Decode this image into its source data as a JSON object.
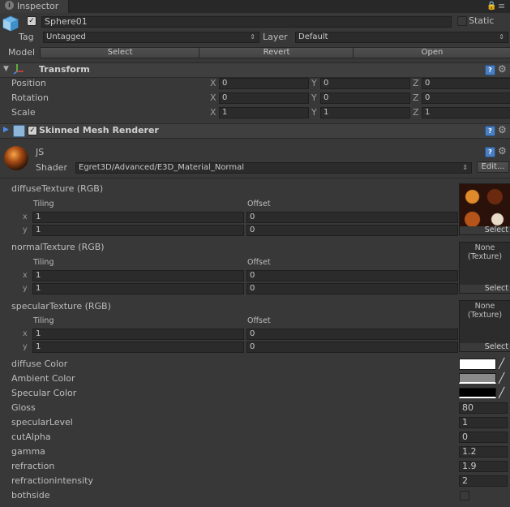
{
  "tab": {
    "label": "Inspector"
  },
  "object": {
    "name": "Sphere01",
    "static_label": "Static",
    "tag_label": "Tag",
    "tag_value": "Untagged",
    "layer_label": "Layer",
    "layer_value": "Default",
    "model_label": "Model",
    "model_buttons": [
      "Select",
      "Revert",
      "Open"
    ]
  },
  "transform": {
    "title": "Transform",
    "rows": [
      {
        "label": "Position",
        "x": "0",
        "y": "0",
        "z": "0"
      },
      {
        "label": "Rotation",
        "x": "0",
        "y": "0",
        "z": "0"
      },
      {
        "label": "Scale",
        "x": "1",
        "y": "1",
        "z": "1"
      }
    ],
    "axes": [
      "X",
      "Y",
      "Z"
    ]
  },
  "renderer": {
    "title": "Skinned Mesh Renderer"
  },
  "material": {
    "name": "JS",
    "shader_label": "Shader",
    "shader_value": "Egret3D/Advanced/E3D_Material_Normal",
    "edit_label": "Edit..."
  },
  "textures": [
    {
      "label": "diffuseTexture (RGB)",
      "tiling_label": "Tiling",
      "offset_label": "Offset",
      "tiling_x": "1",
      "tiling_y": "1",
      "offset_x": "0",
      "offset_y": "0",
      "preview": "image",
      "select_label": "Select"
    },
    {
      "label": "normalTexture (RGB)",
      "tiling_label": "Tiling",
      "offset_label": "Offset",
      "tiling_x": "1",
      "tiling_y": "1",
      "offset_x": "0",
      "offset_y": "0",
      "preview": "None (Texture)",
      "select_label": "Select"
    },
    {
      "label": "specularTexture (RGB)",
      "tiling_label": "Tiling",
      "offset_label": "Offset",
      "tiling_x": "1",
      "tiling_y": "1",
      "offset_x": "0",
      "offset_y": "0",
      "preview": "None (Texture)",
      "select_label": "Select"
    }
  ],
  "axis_x": "x",
  "axis_y": "y",
  "colors": [
    {
      "label": "diffuse Color",
      "hex": "#ffffff"
    },
    {
      "label": "Ambient Color",
      "hex": "#8a8a8a"
    },
    {
      "label": "Specular Color",
      "hex": "#000000"
    }
  ],
  "properties": [
    {
      "label": "Gloss",
      "value": "80"
    },
    {
      "label": "specularLevel",
      "value": "1"
    },
    {
      "label": "cutAlpha",
      "value": "0"
    },
    {
      "label": "gamma",
      "value": "1.2"
    },
    {
      "label": "refraction",
      "value": "1.9"
    },
    {
      "label": "refractionintensity",
      "value": "2"
    }
  ],
  "bothside": {
    "label": "bothside",
    "checked": false
  }
}
